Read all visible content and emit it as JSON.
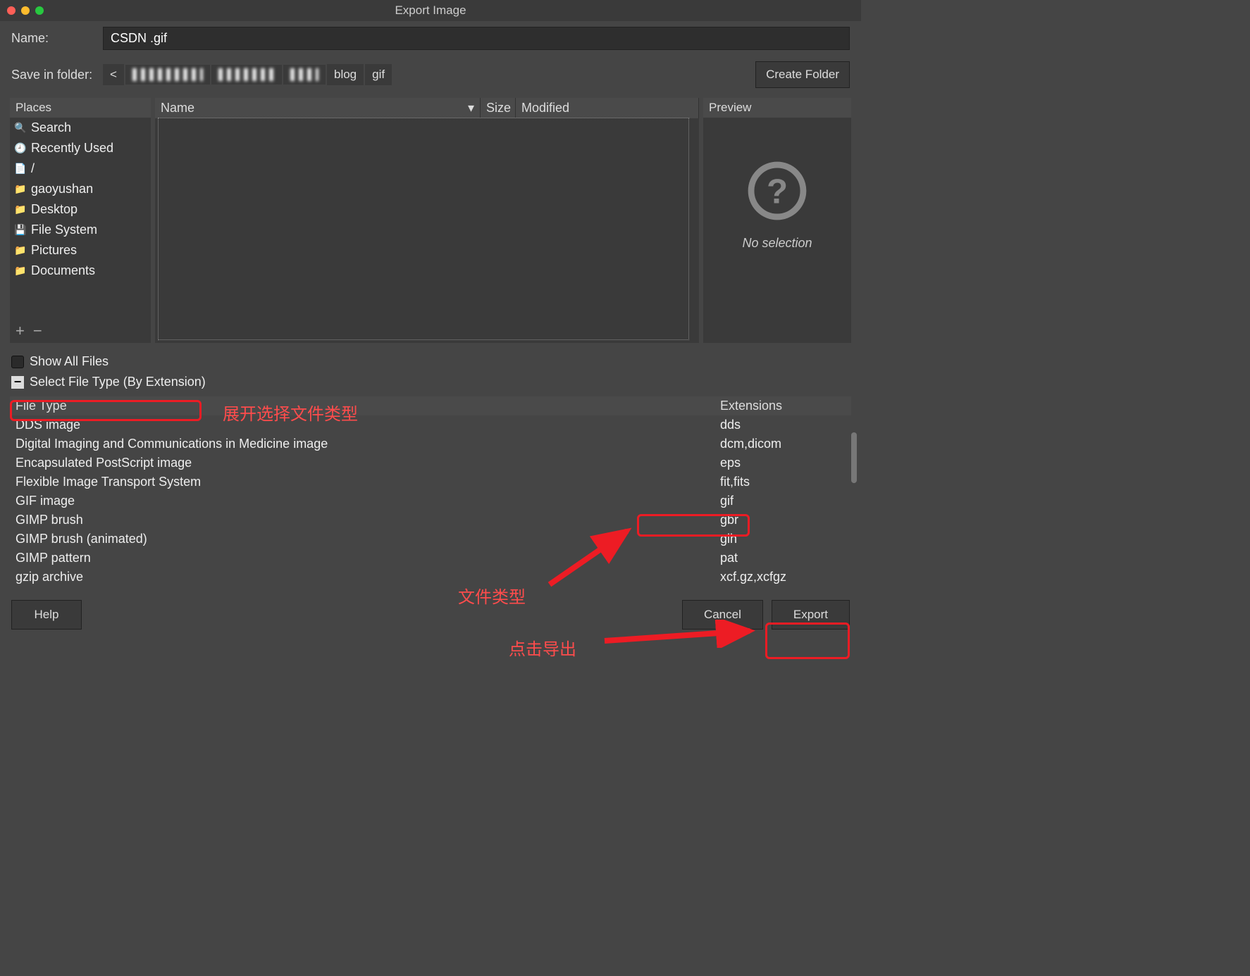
{
  "window": {
    "title": "Export Image"
  },
  "name_row": {
    "label": "Name:",
    "value": "CSDN .gif"
  },
  "folder_row": {
    "label": "Save in folder:",
    "crumbs": [
      "<",
      "…",
      "…",
      "…",
      "blog",
      "gif"
    ],
    "create_folder": "Create Folder"
  },
  "places": {
    "header": "Places",
    "items": [
      {
        "icon": "search-icon",
        "label": "Search"
      },
      {
        "icon": "recent-icon",
        "label": "Recently Used"
      },
      {
        "icon": "file-icon",
        "label": "/"
      },
      {
        "icon": "folder-icon",
        "label": "gaoyushan"
      },
      {
        "icon": "folder-icon",
        "label": "Desktop"
      },
      {
        "icon": "drive-icon",
        "label": "File System"
      },
      {
        "icon": "folder-icon",
        "label": "Pictures"
      },
      {
        "icon": "folder-icon",
        "label": "Documents"
      }
    ]
  },
  "filelist": {
    "columns": {
      "name": "Name",
      "size": "Size",
      "modified": "Modified"
    }
  },
  "preview": {
    "header": "Preview",
    "no_selection": "No selection"
  },
  "options": {
    "show_all": "Show All Files",
    "select_type": "Select File Type (By Extension)"
  },
  "filetype_table": {
    "columns": {
      "type": "File Type",
      "ext": "Extensions"
    },
    "rows": [
      {
        "type": "DDS image",
        "ext": "dds"
      },
      {
        "type": "Digital Imaging and Communications in Medicine image",
        "ext": "dcm,dicom"
      },
      {
        "type": "Encapsulated PostScript image",
        "ext": "eps"
      },
      {
        "type": "Flexible Image Transport System",
        "ext": "fit,fits"
      },
      {
        "type": "GIF image",
        "ext": "gif"
      },
      {
        "type": "GIMP brush",
        "ext": "gbr"
      },
      {
        "type": "GIMP brush (animated)",
        "ext": "gih"
      },
      {
        "type": "GIMP pattern",
        "ext": "pat"
      },
      {
        "type": "gzip archive",
        "ext": "xcf.gz,xcfgz"
      }
    ]
  },
  "buttons": {
    "help": "Help",
    "cancel": "Cancel",
    "export": "Export"
  },
  "annotations": {
    "expand_type": "展开选择文件类型",
    "file_type": "文件类型",
    "click_export": "点击导出"
  }
}
